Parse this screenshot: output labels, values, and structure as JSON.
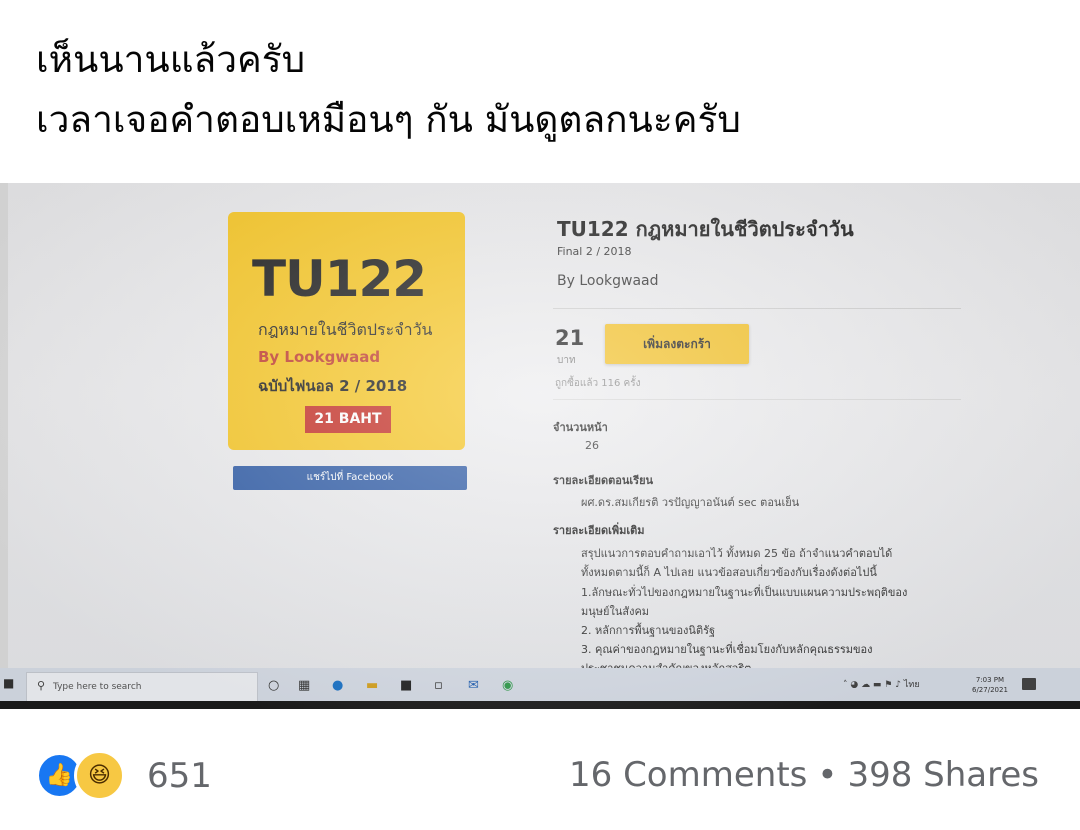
{
  "post": {
    "caption_line1": "เห็นนานแล้วครับ",
    "caption_line2": "เวลาเจอคำตอบเหมือนๆ กัน มันดูตลกนะครับ"
  },
  "photo": {
    "cover": {
      "title": "TU122",
      "subtitle": "กฎหมายในชีวิตประจำวัน",
      "author": "By Lookgwaad",
      "edition": "ฉบับไฟนอล 2 / 2018",
      "price": "21 BAHT"
    },
    "share_button": "แชร์ไปที่ Facebook",
    "product": {
      "title": "TU122 กฎหมายในชีวิตประจำวัน",
      "subtitle": "Final 2 / 2018",
      "by": "By Lookgwaad",
      "price": "21",
      "price_unit": "บาท",
      "cart_button": "เพิ่มลงตะกร้า",
      "sold": "ถูกซื้อแล้ว 116 ครั้ง",
      "pages_label": "จำนวนหน้า",
      "pages_value": "26",
      "class_label": "รายละเอียดตอนเรียน",
      "class_value": "ผศ.ดร.สมเกียรติ วรปัญญาอนันต์ sec ตอนเย็น",
      "detail_label": "รายละเอียดเพิ่มเติม",
      "detail_lines": [
        "สรุปแนวการตอบคำถามเอาไว้ ทั้งหมด 25 ข้อ ถ้าจำแนวคำตอบได้",
        "ทั้งหมดตามนี้ก็ A ไปเลย แนวข้อสอบเกี่ยวข้องกับเรื่องดังต่อไปนี้",
        "1.ลักษณะทั่วไปของกฎหมายในฐานะที่เป็นแบบแผนความประพฤติของ",
        "มนุษย์ในสังคม",
        "2. หลักการพื้นฐานของนิติรัฐ",
        "3. คุณค่าของกฎหมายในฐานะที่เชื่อมโยงกับหลักคุณธรรมของ",
        "ประชาชนความสำคัญของหลักสุจริต"
      ]
    },
    "taskbar": {
      "search_placeholder": "Type here to search",
      "tray_lang": "ไทย",
      "time": "7:03 PM",
      "date": "6/27/2021"
    }
  },
  "footer": {
    "reaction_count": "651",
    "comments": "16 Comments",
    "separator": "•",
    "shares": "398 Shares"
  },
  "colors": {
    "cover_yellow": "#f6c521",
    "price_red": "#c42b22",
    "share_blue": "#2d5aa5",
    "like_blue": "#1877f2",
    "haha_yellow": "#f7c843",
    "meta_gray": "#65676b"
  },
  "icons": [
    "windows-start-icon",
    "search-icon",
    "task-view-icon",
    "edge-icon",
    "file-explorer-icon",
    "store-icon",
    "mail-icon",
    "chrome-icon",
    "like-icon",
    "haha-icon",
    "notification-icon"
  ]
}
